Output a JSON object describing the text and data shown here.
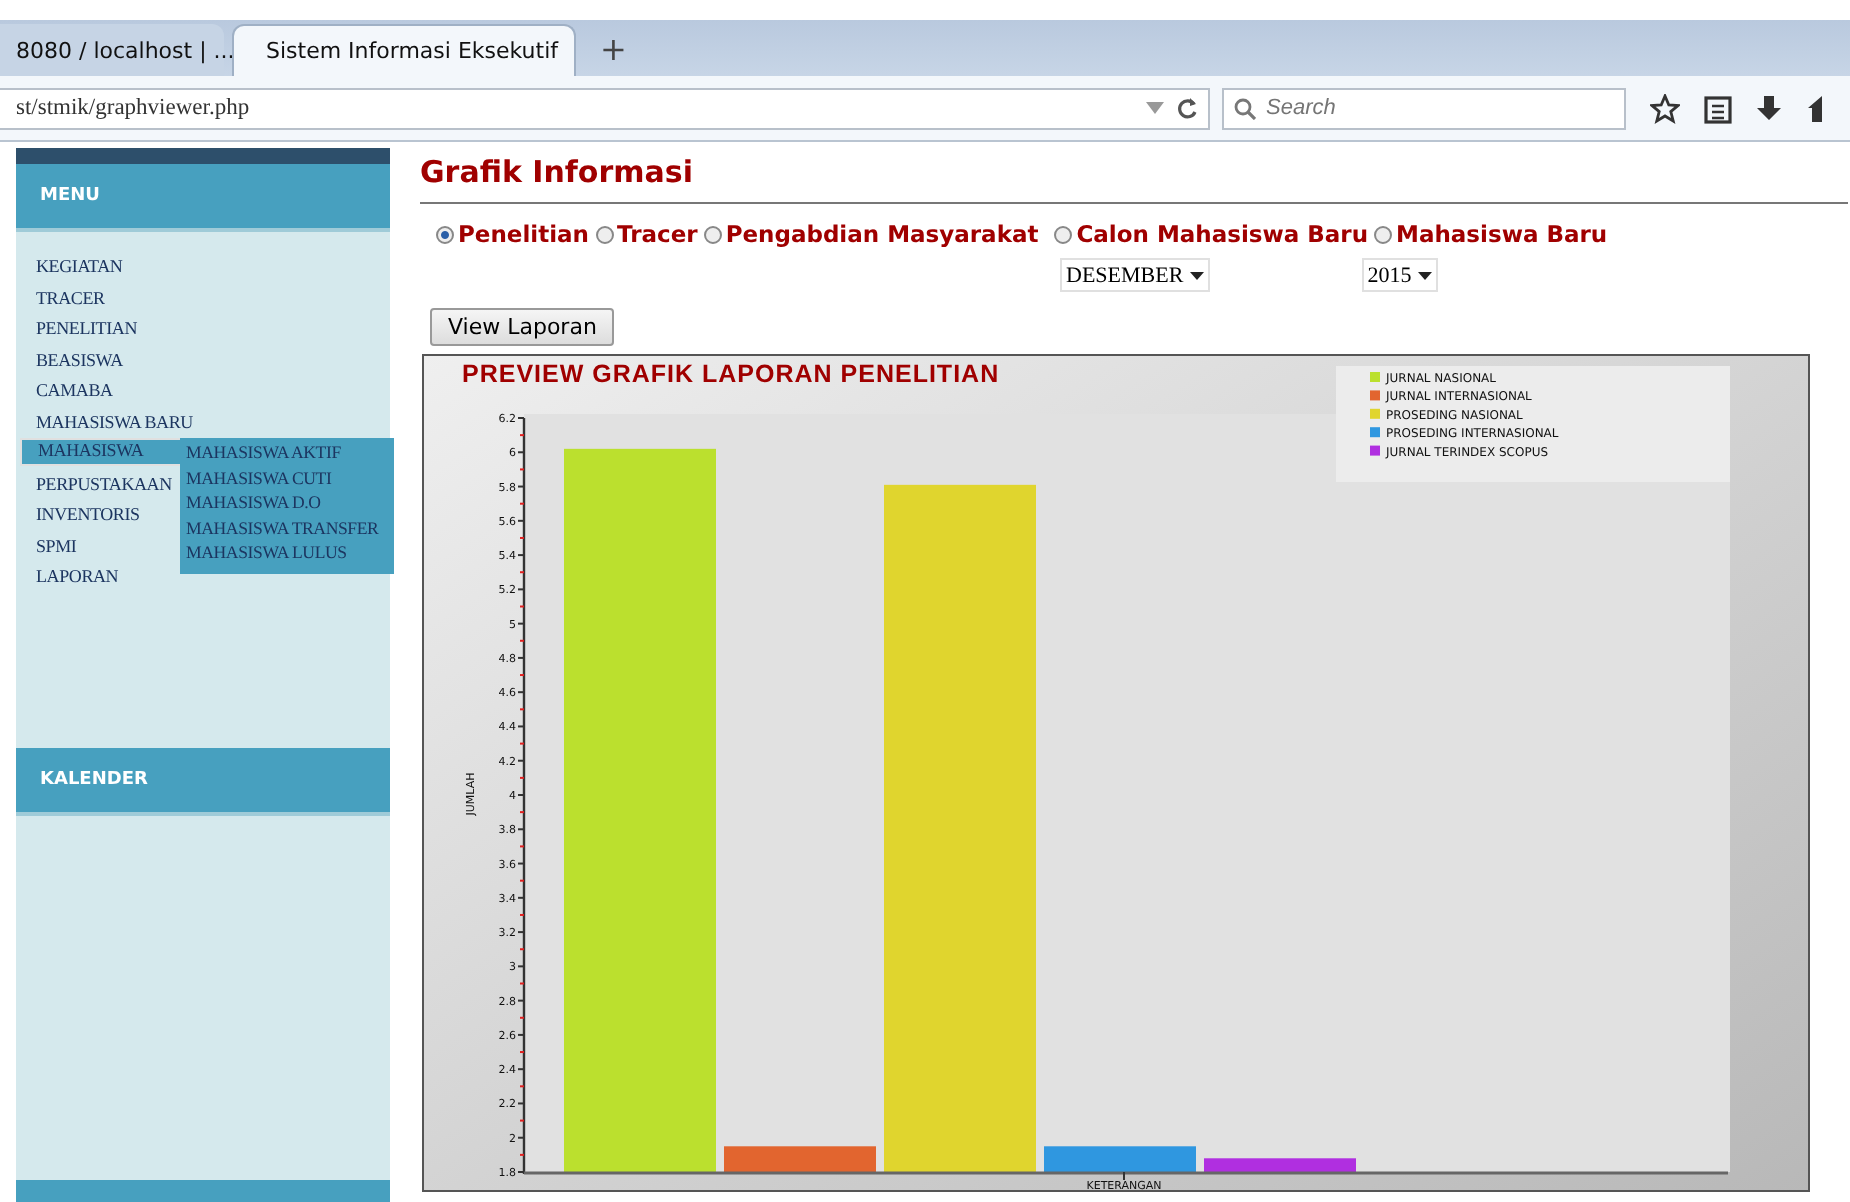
{
  "browser": {
    "tabs": [
      {
        "title": "8080 / localhost | ...",
        "selected": false
      },
      {
        "title": "Sistem Informasi Eksekutif",
        "selected": true
      }
    ],
    "new_tab": "+",
    "url": "st/stmik/graphviewer.php",
    "search_placeholder": "Search"
  },
  "sidebar": {
    "menu_title": "MENU",
    "items": [
      {
        "label": "KEGIATAN",
        "selected": false
      },
      {
        "label": "TRACER",
        "selected": false
      },
      {
        "label": "PENELITIAN",
        "selected": false
      },
      {
        "label": "BEASISWA",
        "selected": false
      },
      {
        "label": "CAMABA",
        "selected": false
      },
      {
        "label": "MAHASISWA BARU",
        "selected": false
      },
      {
        "label": "MAHASISWA",
        "selected": true,
        "children": [
          "MAHASISWA AKTIF",
          "MAHASISWA CUTI",
          "MAHASISWA D.O",
          "MAHASISWA TRANSFER",
          "MAHASISWA LULUS"
        ]
      },
      {
        "label": "PERPUSTAKAAN",
        "selected": false
      },
      {
        "label": "INVENTORIS",
        "selected": false
      },
      {
        "label": "SPMI",
        "selected": false
      },
      {
        "label": "LAPORAN",
        "selected": false
      }
    ],
    "calendar_title": "KALENDER"
  },
  "main": {
    "title": "Grafik Informasi",
    "report_types": [
      {
        "label": "Penelitian",
        "selected": true
      },
      {
        "label": "Tracer",
        "selected": false
      },
      {
        "label": "Pengabdian Masyarakat",
        "selected": false
      },
      {
        "label": "Calon Mahasiswa Baru",
        "selected": false
      },
      {
        "label": "Mahasiswa Baru",
        "selected": false
      }
    ],
    "month": "DESEMBER",
    "year": "2015",
    "button": "View Laporan",
    "chart": {
      "chart_data": {
        "type": "bar",
        "title": "PREVIEW GRAFIK LAPORAN PENELITIAN",
        "xlabel": "KETERANGAN",
        "ylabel": "JUMLAH",
        "ylim": [
          1.8,
          6.2
        ],
        "legend": true,
        "yticks": [
          1.8,
          2,
          2.2,
          2.4,
          2.6,
          2.8,
          3,
          3.2,
          3.4,
          3.6,
          3.8,
          4,
          4.2,
          4.4,
          4.6,
          4.8,
          5,
          5.2,
          5.4,
          5.6,
          5.8,
          6,
          6.2
        ],
        "series": [
          {
            "name": "JURNAL NASIONAL",
            "color": "#bbe02e",
            "values": [
              6.02
            ]
          },
          {
            "name": "JURNAL INTERNASIONAL",
            "color": "#e2652f",
            "values": [
              1.95
            ]
          },
          {
            "name": "PROSEDING NASIONAL",
            "color": "#e0d52e",
            "values": [
              5.81
            ]
          },
          {
            "name": "PROSEDING INTERNASIONAL",
            "color": "#2f97e0",
            "values": [
              1.95
            ]
          },
          {
            "name": "JURNAL TERINDEX SCOPUS",
            "color": "#b02fe0",
            "values": [
              1.88
            ]
          }
        ]
      }
    }
  }
}
